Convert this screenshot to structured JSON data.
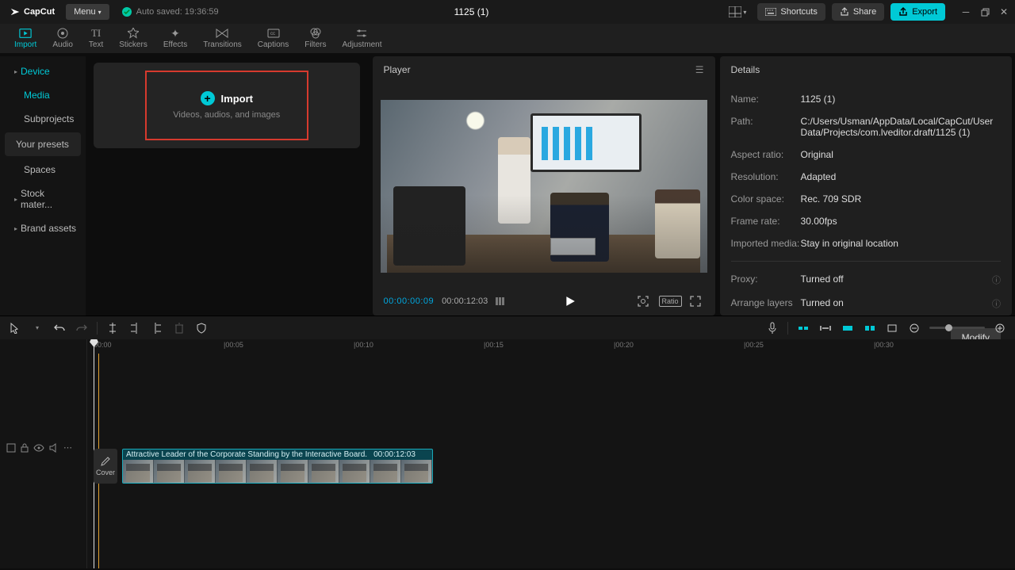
{
  "app": {
    "name": "CapCut"
  },
  "titlebar": {
    "menu": "Menu",
    "autosave": "Auto saved: 19:36:59",
    "title": "1125 (1)",
    "shortcuts": "Shortcuts",
    "share": "Share",
    "export": "Export"
  },
  "tabs": {
    "import": "Import",
    "audio": "Audio",
    "text": "Text",
    "stickers": "Stickers",
    "effects": "Effects",
    "transitions": "Transitions",
    "captions": "Captions",
    "filters": "Filters",
    "adjustment": "Adjustment"
  },
  "sidebar": {
    "device": "Device",
    "media": "Media",
    "subprojects": "Subprojects",
    "presets": "Your presets",
    "spaces": "Spaces",
    "stock": "Stock mater...",
    "brand": "Brand assets"
  },
  "importCard": {
    "label": "Import",
    "sub": "Videos, audios, and images"
  },
  "player": {
    "title": "Player",
    "timecode": "00:00:00:09",
    "duration": "00:00:12:03",
    "ratio": "Ratio"
  },
  "details": {
    "title": "Details",
    "rows": {
      "name": {
        "label": "Name:",
        "value": "1125 (1)"
      },
      "path": {
        "label": "Path:",
        "value": "C:/Users/Usman/AppData/Local/CapCut/User Data/Projects/com.lveditor.draft/1125 (1)"
      },
      "aspect": {
        "label": "Aspect ratio:",
        "value": "Original"
      },
      "resolution": {
        "label": "Resolution:",
        "value": "Adapted"
      },
      "colorspace": {
        "label": "Color space:",
        "value": "Rec. 709 SDR"
      },
      "framerate": {
        "label": "Frame rate:",
        "value": "30.00fps"
      },
      "imported": {
        "label": "Imported media:",
        "value": "Stay in original location"
      },
      "proxy": {
        "label": "Proxy:",
        "value": "Turned off"
      },
      "layers": {
        "label": "Arrange layers",
        "value": "Turned on"
      }
    },
    "modify": "Modify"
  },
  "timeline": {
    "cover": "Cover",
    "clipName": "Attractive Leader of the Corporate Standing by the Interactive Board.",
    "clipDuration": "00:00:12:03",
    "ruler": [
      "00:00",
      "00:05",
      "00:10",
      "00:15",
      "00:20",
      "00:25",
      "00:30"
    ]
  }
}
